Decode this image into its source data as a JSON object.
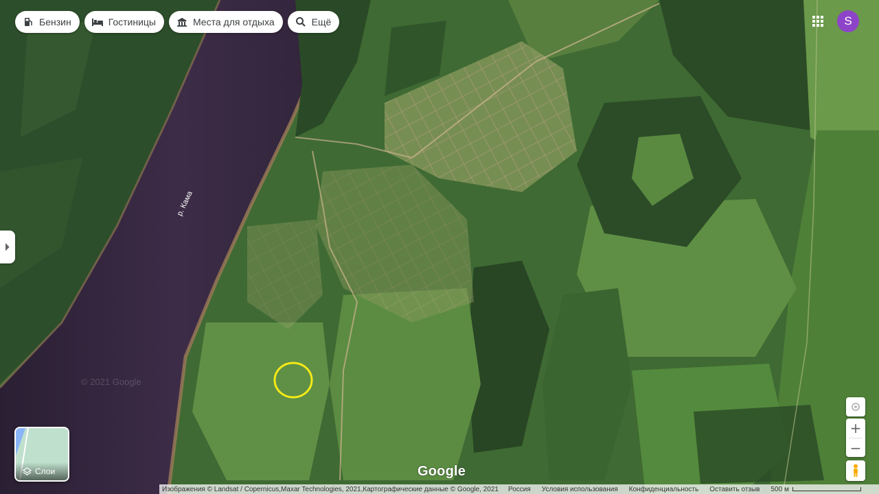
{
  "chips": [
    {
      "label": "Бензин",
      "icon": "gas-station-icon"
    },
    {
      "label": "Гостиницы",
      "icon": "hotel-bed-icon"
    },
    {
      "label": "Места для отдыха",
      "icon": "sightseeing-icon"
    },
    {
      "label": "Ещё",
      "icon": "search-icon"
    }
  ],
  "account": {
    "initial": "S",
    "color": "#8e44c8"
  },
  "map": {
    "type": "satellite",
    "river_label": "р. Кама",
    "watermark": "© 2021 Google",
    "marker_color": "#f7ea16",
    "logo": "Google"
  },
  "layers": {
    "label": "Слои"
  },
  "footer": {
    "attribution": "Изображения © Landsat / Copernicus,Maxar Technologies, 2021,Картографические данные © Google, 2021",
    "country": "Россия",
    "terms": "Условия использования",
    "privacy": "Конфиденциальность",
    "feedback": "Оставить отзыв",
    "scale": "500 м"
  }
}
